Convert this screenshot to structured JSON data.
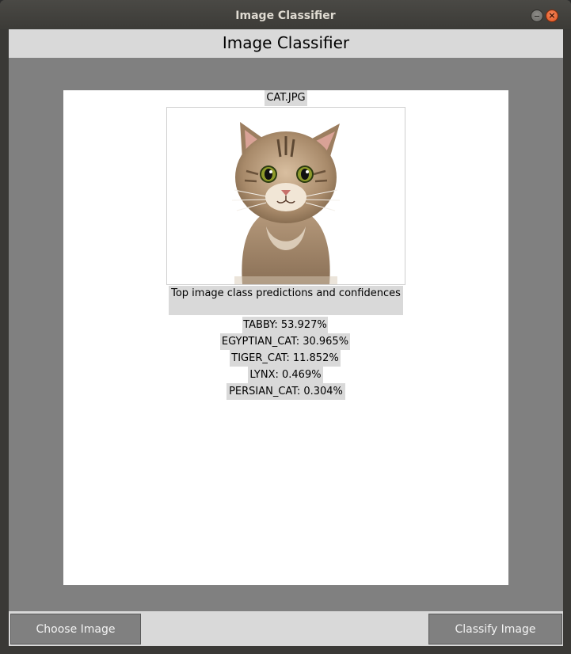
{
  "window": {
    "title": "Image Classifier"
  },
  "header": {
    "title": "Image Classifier"
  },
  "image_panel": {
    "filename": "CAT.JPG",
    "image_icon": "cat-photo"
  },
  "predictions": {
    "heading": "Top image class predictions and confidences",
    "items": [
      "TABBY: 53.927%",
      "EGYPTIAN_CAT: 30.965%",
      "TIGER_CAT: 11.852%",
      "LYNX: 0.469%",
      "PERSIAN_CAT: 0.304%"
    ]
  },
  "buttons": {
    "choose_label": "Choose Image",
    "classify_label": "Classify Image"
  },
  "colors": {
    "panel_gray": "#808080",
    "label_bg": "#d9d9d9",
    "canvas_bg": "#ffffff",
    "close_button": "#e2531f"
  }
}
